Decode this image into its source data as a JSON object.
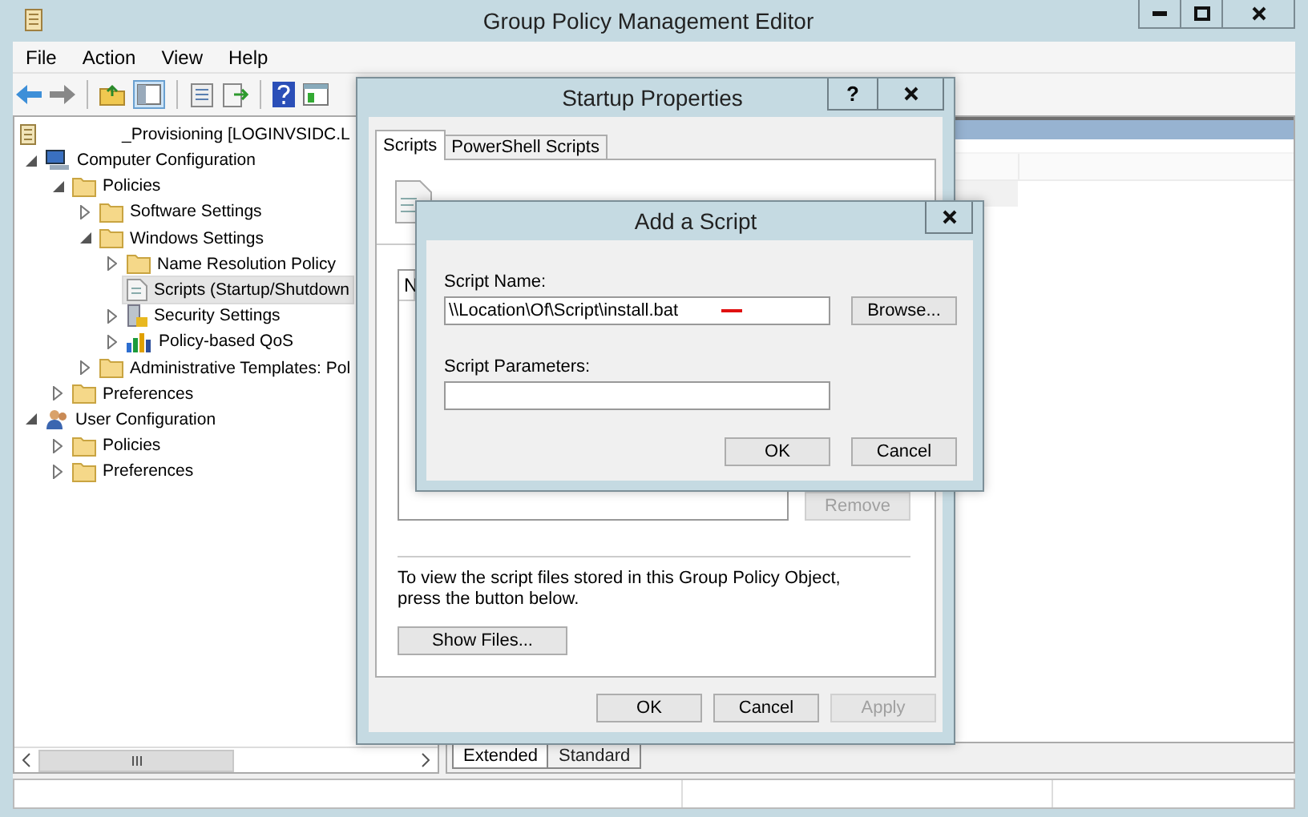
{
  "window": {
    "title": "Group Policy Management Editor"
  },
  "menu": [
    "File",
    "Action",
    "View",
    "Help"
  ],
  "tree": {
    "root": "_Provisioning [LOGINVSIDC.L",
    "items": [
      {
        "label": "Computer Configuration",
        "kind": "computer",
        "expanded": true,
        "selected": false,
        "children": [
          {
            "label": "Policies",
            "kind": "folder",
            "expanded": true,
            "selected": false,
            "children": [
              {
                "label": "Software Settings",
                "kind": "folder",
                "expanded": false,
                "selected": false
              },
              {
                "label": "Windows Settings",
                "kind": "folder",
                "expanded": true,
                "selected": false,
                "children": [
                  {
                    "label": "Name Resolution Policy",
                    "kind": "folder",
                    "expanded": false,
                    "selected": false
                  },
                  {
                    "label": "Scripts (Startup/Shutdown",
                    "kind": "script",
                    "selected": true
                  },
                  {
                    "label": "Security Settings",
                    "kind": "security",
                    "expanded": false,
                    "selected": false
                  },
                  {
                    "label": "Policy-based QoS",
                    "kind": "qos",
                    "expanded": false,
                    "selected": false
                  }
                ]
              },
              {
                "label": "Administrative Templates: Pol",
                "kind": "folder",
                "expanded": false,
                "selected": false
              }
            ]
          },
          {
            "label": "Preferences",
            "kind": "folder",
            "expanded": false,
            "selected": false
          }
        ]
      },
      {
        "label": "User Configuration",
        "kind": "user",
        "expanded": true,
        "selected": false,
        "children": [
          {
            "label": "Policies",
            "kind": "folder",
            "expanded": false,
            "selected": false
          },
          {
            "label": "Preferences",
            "kind": "folder",
            "expanded": false,
            "selected": false
          }
        ]
      }
    ]
  },
  "view_tabs": [
    {
      "label": "Extended",
      "selected": true
    },
    {
      "label": "Standard",
      "selected": false
    }
  ],
  "startup_dialog": {
    "title": "Startup Properties",
    "help": "?",
    "tabs": [
      {
        "label": "Scripts",
        "selected": true
      },
      {
        "label": "PowerShell Scripts",
        "selected": false
      }
    ],
    "list_columns": [
      "N"
    ],
    "side_buttons": [
      {
        "label": "Remove",
        "disabled": true
      }
    ],
    "note": "To view the script files stored in this Group Policy Object, press the button below.",
    "show_files": "Show Files...",
    "buttons": [
      {
        "label": "OK",
        "disabled": false
      },
      {
        "label": "Cancel",
        "disabled": false
      },
      {
        "label": "Apply",
        "disabled": true
      }
    ]
  },
  "add_dialog": {
    "title": "Add a Script",
    "fields": [
      {
        "label": "Script Name:",
        "value": "\\\\Location\\Of\\Script\\install.bat",
        "marked": true
      },
      {
        "label": "Script Parameters:"
      }
    ],
    "browse": "Browse...",
    "buttons": [
      "OK",
      "Cancel"
    ]
  }
}
